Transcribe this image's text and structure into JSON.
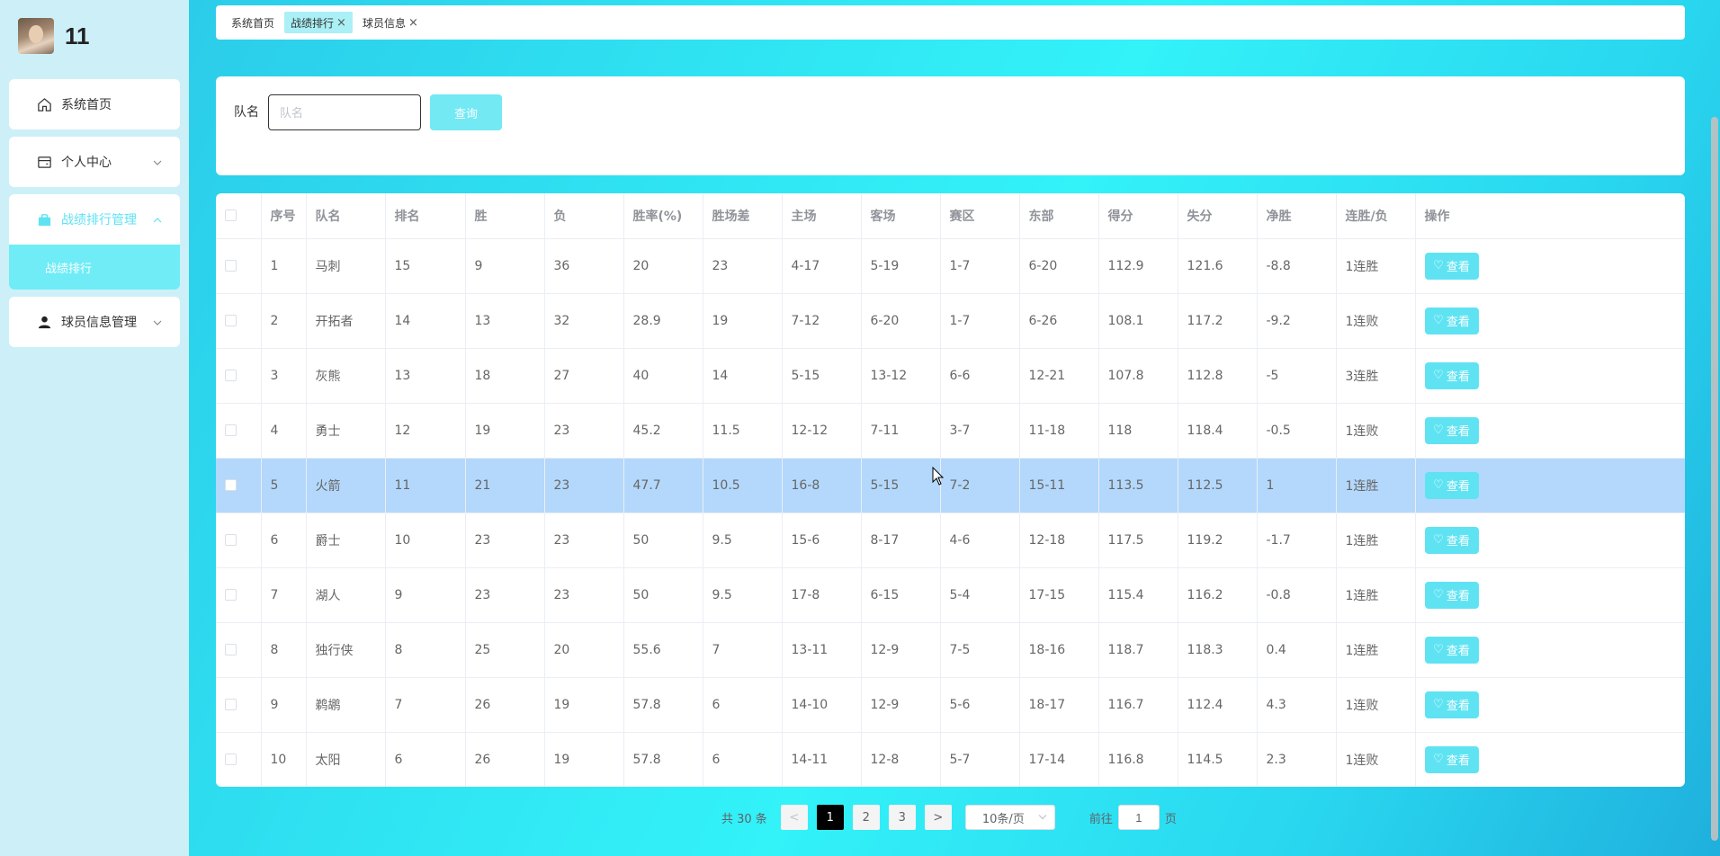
{
  "user": {
    "name": "11"
  },
  "sidebar": {
    "items": [
      {
        "label": "系统首页",
        "icon": "home-icon"
      },
      {
        "label": "个人中心",
        "icon": "wallet-icon"
      },
      {
        "label": "战绩排行管理",
        "icon": "briefcase-icon",
        "active": true,
        "sub": "战绩排行"
      },
      {
        "label": "球员信息管理",
        "icon": "user-icon"
      }
    ]
  },
  "tabs": [
    {
      "label": "系统首页"
    },
    {
      "label": "战绩排行",
      "close": "×"
    },
    {
      "label": "球员信息",
      "close": "×"
    }
  ],
  "search": {
    "label": "队名",
    "placeholder": "队名",
    "button": "查询"
  },
  "table": {
    "headers": [
      "序号",
      "队名",
      "排名",
      "胜",
      "负",
      "胜率(%)",
      "胜场差",
      "主场",
      "客场",
      "赛区",
      "东部",
      "得分",
      "失分",
      "净胜",
      "连胜/负",
      "操作"
    ],
    "view_label": "查看",
    "rows": [
      [
        "1",
        "马刺",
        "15",
        "9",
        "36",
        "20",
        "23",
        "4-17",
        "5-19",
        "1-7",
        "6-20",
        "112.9",
        "121.6",
        "-8.8",
        "1连胜"
      ],
      [
        "2",
        "开拓者",
        "14",
        "13",
        "32",
        "28.9",
        "19",
        "7-12",
        "6-20",
        "1-7",
        "6-26",
        "108.1",
        "117.2",
        "-9.2",
        "1连败"
      ],
      [
        "3",
        "灰熊",
        "13",
        "18",
        "27",
        "40",
        "14",
        "5-15",
        "13-12",
        "6-6",
        "12-21",
        "107.8",
        "112.8",
        "-5",
        "3连胜"
      ],
      [
        "4",
        "勇士",
        "12",
        "19",
        "23",
        "45.2",
        "11.5",
        "12-12",
        "7-11",
        "3-7",
        "11-18",
        "118",
        "118.4",
        "-0.5",
        "1连败"
      ],
      [
        "5",
        "火箭",
        "11",
        "21",
        "23",
        "47.7",
        "10.5",
        "16-8",
        "5-15",
        "7-2",
        "15-11",
        "113.5",
        "112.5",
        "1",
        "1连胜"
      ],
      [
        "6",
        "爵士",
        "10",
        "23",
        "23",
        "50",
        "9.5",
        "15-6",
        "8-17",
        "4-6",
        "12-18",
        "117.5",
        "119.2",
        "-1.7",
        "1连胜"
      ],
      [
        "7",
        "湖人",
        "9",
        "23",
        "23",
        "50",
        "9.5",
        "17-8",
        "6-15",
        "5-4",
        "17-15",
        "115.4",
        "116.2",
        "-0.8",
        "1连胜"
      ],
      [
        "8",
        "独行侠",
        "8",
        "25",
        "20",
        "55.6",
        "7",
        "13-11",
        "12-9",
        "7-5",
        "18-16",
        "118.7",
        "118.3",
        "0.4",
        "1连胜"
      ],
      [
        "9",
        "鹈鹕",
        "7",
        "26",
        "19",
        "57.8",
        "6",
        "14-10",
        "12-9",
        "5-6",
        "18-17",
        "116.7",
        "112.4",
        "4.3",
        "1连败"
      ],
      [
        "10",
        "太阳",
        "6",
        "26",
        "19",
        "57.8",
        "6",
        "14-11",
        "12-8",
        "5-7",
        "17-14",
        "116.8",
        "114.5",
        "2.3",
        "1连败"
      ]
    ],
    "highlight_row": 5
  },
  "pagination": {
    "total": "共 30 条",
    "prev": "<",
    "next": ">",
    "pages": [
      "1",
      "2",
      "3"
    ],
    "current": "1",
    "size": "10条/页",
    "goto_prefix": "前往",
    "goto_value": "1",
    "goto_suffix": "页"
  },
  "colors": {
    "accent": "#5fe3f2",
    "highlight": "#b3d8fb",
    "sidebar_bg": "#cdf0f8"
  }
}
